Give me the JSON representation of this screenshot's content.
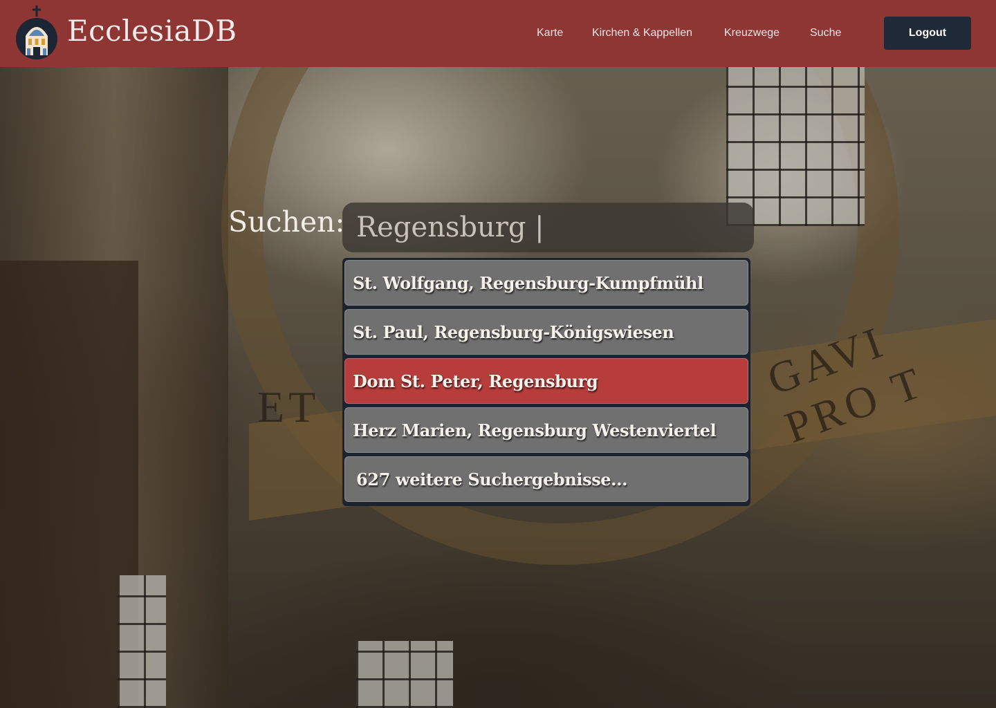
{
  "brand": {
    "name": "EcclesiaDB",
    "logo_icon": "church-icon"
  },
  "nav": {
    "items": [
      "Karte",
      "Kirchen & Kappellen",
      "Kreuzwege",
      "Suche"
    ],
    "logout_label": "Logout"
  },
  "search": {
    "label": "Suchen:",
    "value": "Regensburg |",
    "results": [
      {
        "text": "St. Wolfgang, Regensburg-Kumpfmühl",
        "selected": false
      },
      {
        "text": "St. Paul, Regensburg-Königswiesen",
        "selected": false
      },
      {
        "text": "Dom St. Peter, Regensburg",
        "selected": true
      },
      {
        "text": "Herz Marien, Regensburg Westenviertel",
        "selected": false
      }
    ],
    "more_results": "627 weitere Suchergebnisse..."
  },
  "background": {
    "inscription_left": "ET",
    "inscription_right": "GAVI PRO T"
  },
  "colors": {
    "header": "#8e3634",
    "logout_button": "#1f2937",
    "selected_result": "#b63d3b",
    "result": "#767676"
  }
}
